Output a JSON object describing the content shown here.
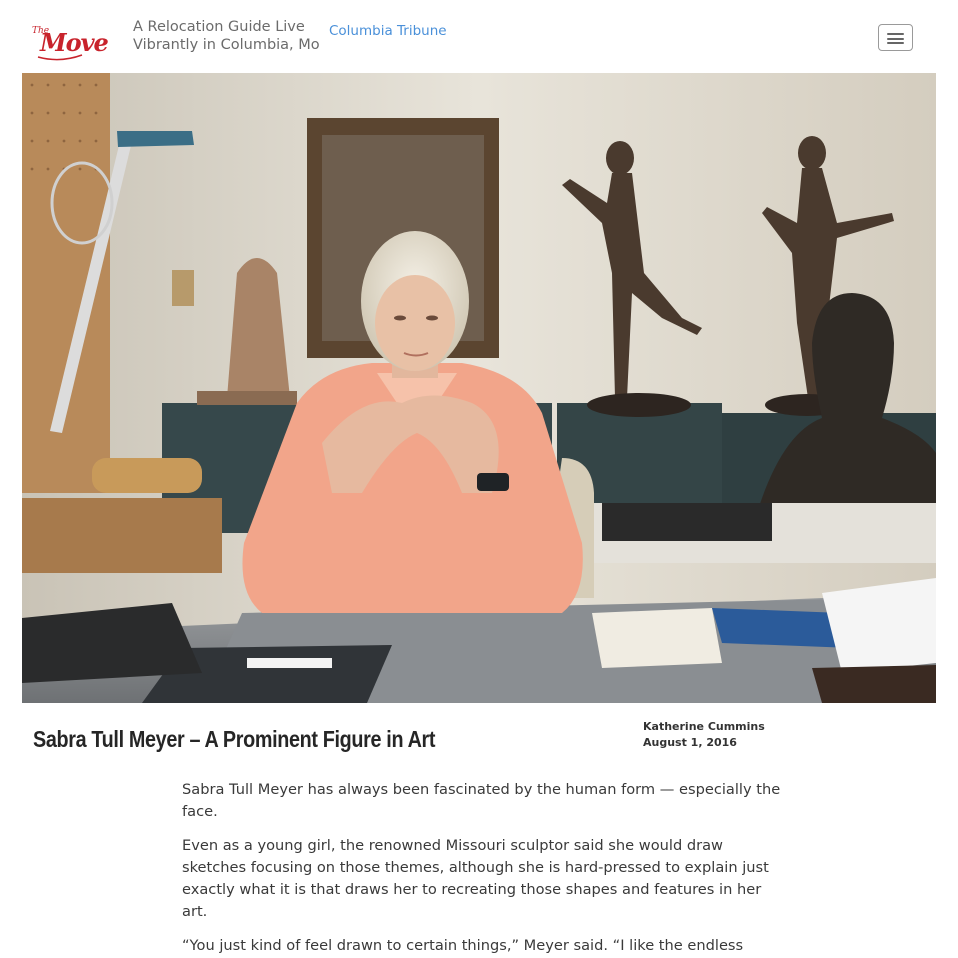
{
  "header": {
    "logo_text": "The Move",
    "tagline_line1": "A Relocation Guide Live",
    "tagline_line2": "Vibrantly in Columbia, Mo",
    "tribune_link": "Columbia Tribune",
    "menu_icon": "hamburger-menu-icon"
  },
  "hero": {
    "description": "Photo of sculptor seated at a desk in her studio surrounded by bronze sculptures"
  },
  "article": {
    "title": "Sabra Tull Meyer – A Prominent Figure in Art",
    "author": "Katherine Cummins",
    "date": "August 1, 2016",
    "paragraphs": [
      "Sabra Tull Meyer has always been fascinated by the human form — especially the face.",
      "Even as a young girl, the renowned Missouri sculptor said she would draw sketches focusing on those themes, although she is hard-pressed to explain just exactly what it is that draws her to recreating those shapes and features in her art.",
      "“You just kind of feel drawn to certain things,” Meyer said. “I like the endless"
    ]
  },
  "colors": {
    "link": "#4a90d9",
    "logo_red": "#c8232c",
    "shirt": "#f2a58a"
  }
}
